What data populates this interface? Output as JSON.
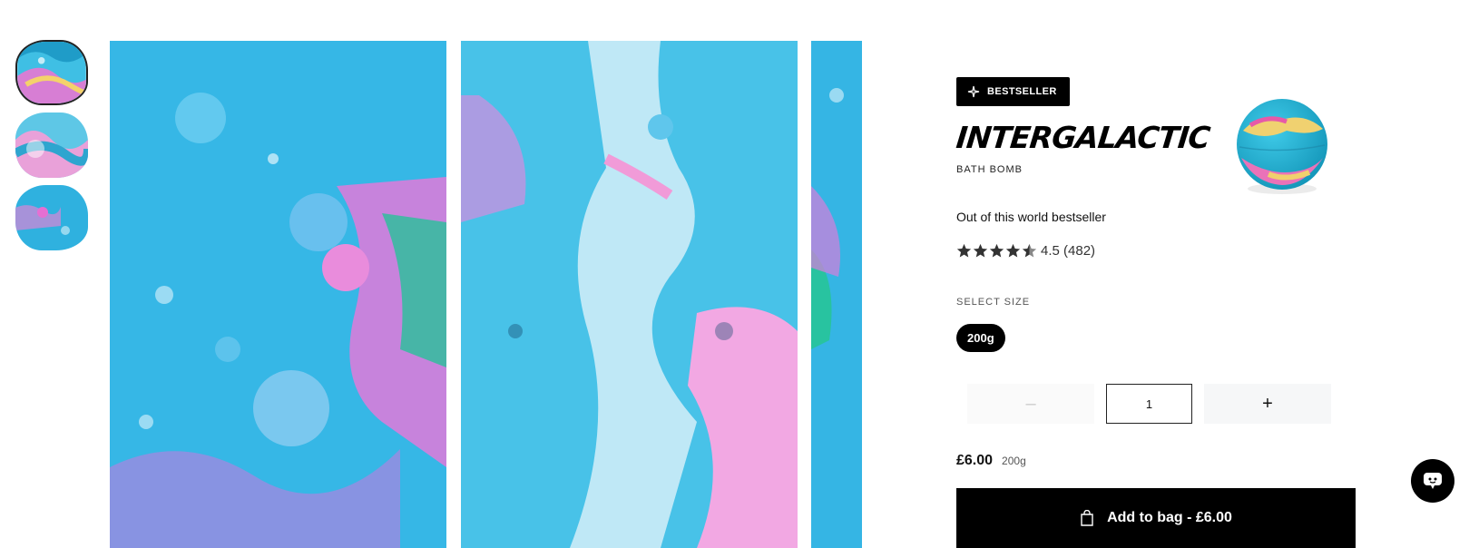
{
  "gallery": {
    "thumbnails": [
      "thumbnail-1",
      "thumbnail-2",
      "thumbnail-3"
    ],
    "active_thumbnail": 1
  },
  "product": {
    "badge": "BESTSELLER",
    "title": "INTERGALACTIC",
    "category": "BATH BOMB",
    "tagline": "Out of this world bestseller",
    "rating_value": 4.5,
    "rating_text": "4.5 (482)",
    "stars_total": 5,
    "size_label": "SELECT SIZE",
    "size_option": "200g",
    "quantity": "1",
    "minus_label": "–",
    "plus_label": "+",
    "price": "£6.00",
    "price_size": "200g",
    "add_to_bag_label": "Add to bag - £6.00"
  },
  "icons": {
    "badge": "sparkle-icon",
    "bag": "shopping-bag-icon",
    "chat": "chat-icon"
  },
  "colors": {
    "primary": "#000000",
    "accent_blue": "#2ab4e3",
    "accent_pink": "#e86ad8"
  }
}
